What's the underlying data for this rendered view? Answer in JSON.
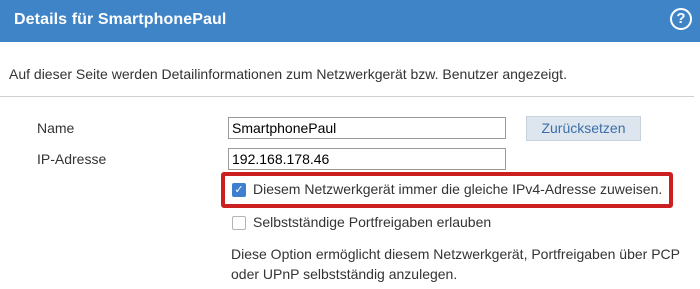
{
  "header": {
    "title": "Details für SmartphonePaul",
    "help_icon": "?"
  },
  "intro": "Auf dieser Seite werden Detailinformationen zum Netzwerkgerät bzw. Benutzer angezeigt.",
  "form": {
    "name_label": "Name",
    "name_value": "SmartphonePaul",
    "ip_label": "IP-Adresse",
    "ip_value": "192.168.178.46",
    "reset_label": "Zurücksetzen"
  },
  "options": {
    "same_ipv4_label": "Diesem Netzwerkgerät immer die gleiche IPv4-Adresse zuweisen.",
    "same_ipv4_checked": true,
    "port_forwarding_label": "Selbstständige Portfreigaben erlauben",
    "port_forwarding_checked": false,
    "port_forwarding_description": "Diese Option ermöglicht diesem Netzwerkgerät, Portfreigaben über PCP oder UPnP selbstständig anzulegen."
  },
  "colors": {
    "header_bg": "#3e84c7",
    "highlight": "#cc1f1f",
    "checkbox_checked": "#3e7fd0",
    "button_bg": "#dde6ef"
  }
}
